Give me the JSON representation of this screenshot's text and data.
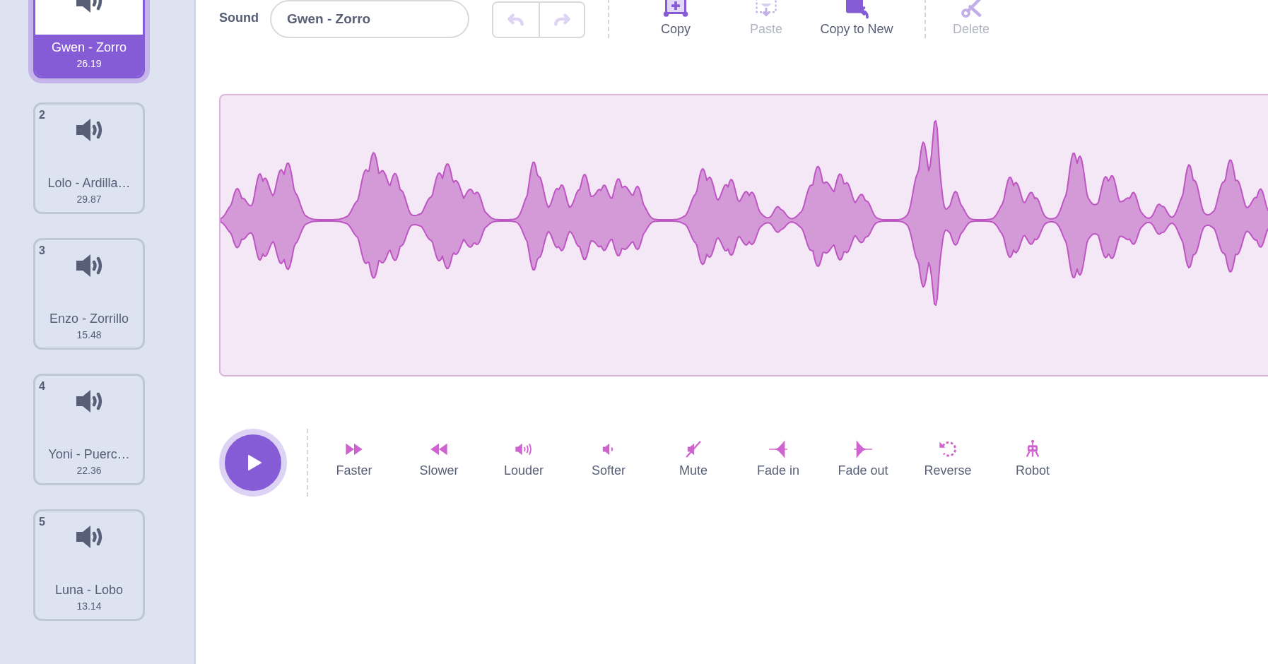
{
  "sounds": [
    {
      "name": "Gwen - Zorro",
      "duration": "26.19",
      "selected": true
    },
    {
      "number": "2",
      "name": "Lolo - Ardilla…",
      "duration": "29.87",
      "selected": false
    },
    {
      "number": "3",
      "name": "Enzo - Zorrillo",
      "duration": "15.48",
      "selected": false
    },
    {
      "number": "4",
      "name": "Yoni - Puerc…",
      "duration": "22.36",
      "selected": false
    },
    {
      "number": "5",
      "name": "Luna - Lobo",
      "duration": "13.14",
      "selected": false
    }
  ],
  "editor": {
    "label": "Sound",
    "name_value": "Gwen - Zorro",
    "undo": {
      "disabled": true
    },
    "redo": {
      "disabled": true
    }
  },
  "actions": [
    {
      "kind": "copy",
      "label": "Copy",
      "disabled": false
    },
    {
      "kind": "paste",
      "label": "Paste",
      "disabled": true
    },
    {
      "kind": "copy_to_new",
      "label": "Copy to New",
      "disabled": false
    },
    {
      "kind": "divider"
    },
    {
      "kind": "delete",
      "label": "Delete",
      "disabled": true
    }
  ],
  "effects": [
    {
      "kind": "faster",
      "label": "Faster"
    },
    {
      "kind": "slower",
      "label": "Slower"
    },
    {
      "kind": "louder",
      "label": "Louder"
    },
    {
      "kind": "softer",
      "label": "Softer"
    },
    {
      "kind": "mute",
      "label": "Mute"
    },
    {
      "kind": "fade_in",
      "label": "Fade in"
    },
    {
      "kind": "fade_out",
      "label": "Fade out"
    },
    {
      "kind": "reverse",
      "label": "Reverse"
    },
    {
      "kind": "robot",
      "label": "Robot"
    }
  ]
}
